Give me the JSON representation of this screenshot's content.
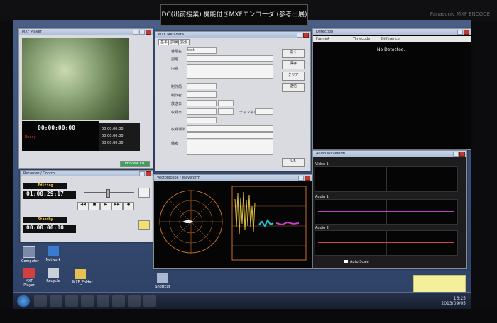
{
  "banner": {
    "title": "DC(出前授業) 機能付きMXFエンコーダ (参考出展)"
  },
  "brand": {
    "text": "Panasonic  MXF ENCODE"
  },
  "player": {
    "title": "MXF Player",
    "timecode": "00:00:00:00",
    "status": "Ready",
    "tc_rows": [
      "00:00:00:00",
      "00:00:00:00",
      "00:00:00:00"
    ],
    "ok_label": "Preview OK"
  },
  "recorder": {
    "title": "Recorder / Control",
    "mode_label": "Editing",
    "tc_top": "01:00:29:17",
    "mode2_label": "Standby",
    "tc_bottom": "00:00:00:00",
    "transport": [
      "◀◀",
      "■",
      "▶",
      "▶▶",
      "●"
    ]
  },
  "metadata": {
    "title": "MXF Metadata",
    "tabs": [
      "基本",
      "詳細",
      "拡張"
    ],
    "fields": [
      {
        "label": "番組名",
        "value": "test"
      },
      {
        "label": "副題",
        "value": ""
      },
      {
        "label": "内容",
        "value": ""
      },
      {
        "label": "制作局",
        "value": ""
      },
      {
        "label": "制作者",
        "value": ""
      },
      {
        "label": "放送日",
        "value": ""
      },
      {
        "label": "収録日",
        "value": ""
      },
      {
        "label": "収録場所",
        "value": ""
      },
      {
        "label": "備考",
        "value": ""
      }
    ],
    "side_buttons": [
      "開く",
      "保存",
      "クリア",
      "送信"
    ],
    "bottom_button": "OK",
    "mini_label": "チャンネル"
  },
  "detect": {
    "title": "Detection",
    "columns": [
      "Frame#",
      "Timecode",
      "Difference"
    ],
    "message": "No Detected."
  },
  "scope": {
    "title": "Vectorscope / Waveform"
  },
  "waveform": {
    "title": "Audio Waveform",
    "sections": [
      "Video 1",
      "Audio 1",
      "Audio 2"
    ],
    "footer": "Auto Scale"
  },
  "desktop_icons": [
    {
      "label": "Computer"
    },
    {
      "label": "Network"
    },
    {
      "label": "MXF Player"
    },
    {
      "label": "Recycle"
    },
    {
      "label": "MXF_Folder"
    },
    {
      "label": "Shortcut"
    }
  ],
  "clock": {
    "time": "16:25",
    "date": "2013/09/05"
  },
  "colors": {
    "accent": "#c0392b",
    "scope_trace": "#e0c040",
    "cyan_trace": "#20c8d8",
    "magenta_trace": "#c040c8",
    "green_line": "#30c040"
  }
}
